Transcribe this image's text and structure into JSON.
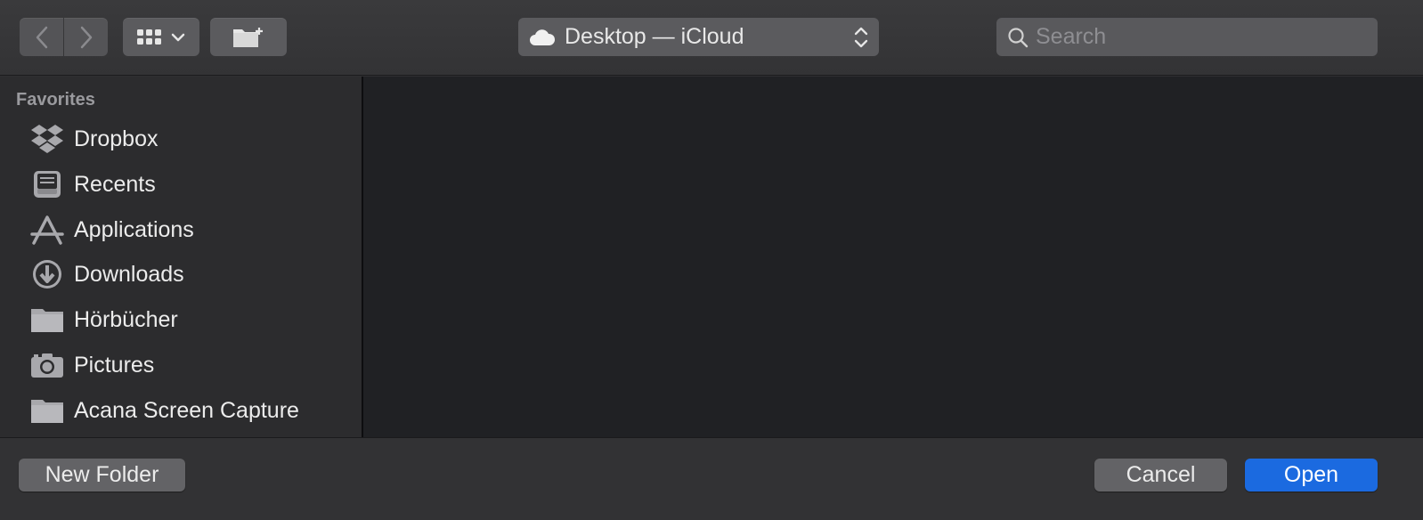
{
  "toolbar": {
    "location_label": "Desktop — iCloud",
    "search_placeholder": "Search"
  },
  "sidebar": {
    "section_title": "Favorites",
    "items": [
      {
        "label": "Dropbox",
        "icon": "dropbox-icon"
      },
      {
        "label": "Recents",
        "icon": "recents-icon"
      },
      {
        "label": "Applications",
        "icon": "applications-icon"
      },
      {
        "label": "Downloads",
        "icon": "downloads-icon"
      },
      {
        "label": "Hörbücher",
        "icon": "folder-icon"
      },
      {
        "label": "Pictures",
        "icon": "camera-icon"
      },
      {
        "label": "Acana Screen Capture",
        "icon": "folder-icon"
      }
    ]
  },
  "bottom": {
    "new_folder_label": "New Folder",
    "cancel_label": "Cancel",
    "open_label": "Open"
  },
  "colors": {
    "accent": "#1b6ae0",
    "background": "#202124",
    "sidebar": "#2c2c2e"
  }
}
